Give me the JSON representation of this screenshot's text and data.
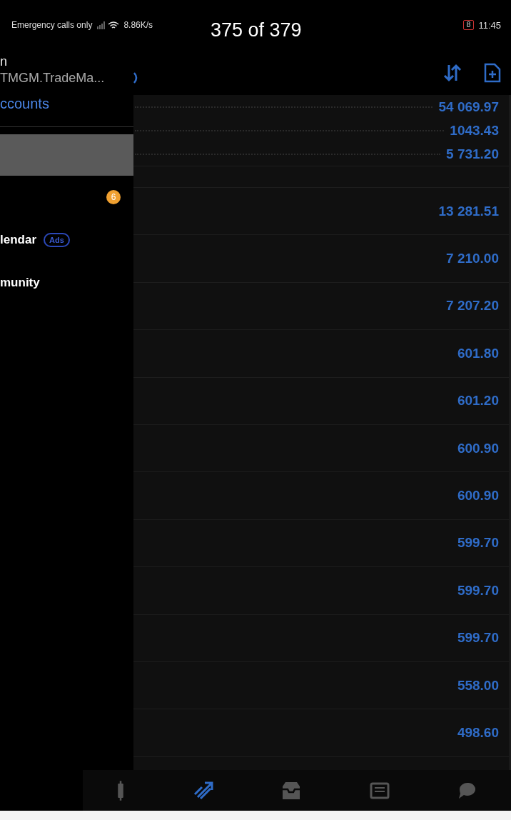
{
  "status_bar": {
    "carrier": "Emergency calls only",
    "speed": "8.86K/s",
    "battery": "8",
    "time": "11:45"
  },
  "viewer_counter": "375 of 379",
  "drawer": {
    "title": "n",
    "subtitle": "TMGM.TradeMa...",
    "accounts_link": "ccounts",
    "items": [
      {
        "selected": true
      },
      {
        "selected": false,
        "badge": "6"
      },
      {
        "selected": false,
        "label": "lendar",
        "tag": "Ads"
      },
      {
        "selected": false,
        "label": "munity"
      }
    ]
  },
  "rows": [
    {
      "kind": "dotted",
      "value": "54 069.97"
    },
    {
      "kind": "dotted",
      "value": "1043.43"
    },
    {
      "kind": "dotted",
      "value": "5 731.20"
    },
    {
      "kind": "blank"
    },
    {
      "kind": "plain",
      "value": "13 281.51"
    },
    {
      "kind": "plain",
      "value": "7 210.00"
    },
    {
      "kind": "plain",
      "value": "7 207.20"
    },
    {
      "kind": "plain",
      "value": "601.80"
    },
    {
      "kind": "plain",
      "value": "601.20"
    },
    {
      "kind": "plain",
      "value": "600.90"
    },
    {
      "kind": "plain",
      "value": "600.90"
    },
    {
      "kind": "plain",
      "value": "599.70"
    },
    {
      "kind": "plain",
      "value": "599.70"
    },
    {
      "kind": "plain",
      "value": "599.70"
    },
    {
      "kind": "plain",
      "value": "558.00"
    },
    {
      "kind": "plain",
      "value": "498.60"
    }
  ],
  "bottom_nav": [
    {
      "kind": "candles",
      "selected": false
    },
    {
      "kind": "trend",
      "selected": true
    },
    {
      "kind": "inbox",
      "selected": false
    },
    {
      "kind": "news",
      "selected": false
    },
    {
      "kind": "chat",
      "selected": false
    }
  ]
}
